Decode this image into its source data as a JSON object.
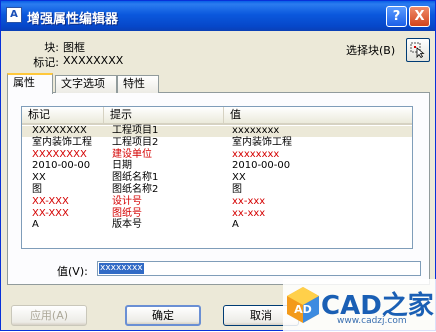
{
  "window": {
    "title": "增强属性编辑器",
    "title_icon": "A",
    "help_glyph": "?",
    "close_glyph": "X"
  },
  "info": {
    "block_label": "块:",
    "block_value": "图框",
    "tag_label": "标记:",
    "tag_value": "XXXXXXXX",
    "select_label": "选择块(B)",
    "select_icon": "pick-cursor-icon"
  },
  "tabs": [
    {
      "label": "属性"
    },
    {
      "label": "文字选项"
    },
    {
      "label": "特性"
    }
  ],
  "table": {
    "headers": [
      "标记",
      "提示",
      "值"
    ],
    "rows": [
      {
        "tag": "XXXXXXXX",
        "prompt": "工程项目1",
        "value": "xxxxxxxx",
        "red": false,
        "selected": true
      },
      {
        "tag": "室内装饰工程",
        "prompt": "工程项目2",
        "value": "室内装饰工程",
        "red": false,
        "selected": false
      },
      {
        "tag": "XXXXXXXX",
        "prompt": "建设单位",
        "value": "xxxxxxxx",
        "red": true,
        "selected": false
      },
      {
        "tag": "2010-00-00",
        "prompt": "日期",
        "value": "2010-00-00",
        "red": false,
        "selected": false
      },
      {
        "tag": "XX",
        "prompt": "图纸名称1",
        "value": "XX",
        "red": false,
        "selected": false
      },
      {
        "tag": "图",
        "prompt": "图纸名称2",
        "value": "图",
        "red": false,
        "selected": false
      },
      {
        "tag": "XX-XXX",
        "prompt": "设计号",
        "value": "xx-xxx",
        "red": true,
        "selected": false
      },
      {
        "tag": "XX-XXX",
        "prompt": "图纸号",
        "value": "xx-xxx",
        "red": true,
        "selected": false
      },
      {
        "tag": "A",
        "prompt": "版本号",
        "value": "A",
        "red": false,
        "selected": false
      }
    ]
  },
  "value_field": {
    "label": "值(V):",
    "value": "xxxxxxxx"
  },
  "buttons": {
    "apply": "应用(A)",
    "ok": "确定",
    "cancel": "取消"
  },
  "watermark": {
    "text": "CAD之家",
    "url": "www.cadzj.com"
  },
  "colors": {
    "title_bar": "#0a58dd",
    "red_text": "#d40000",
    "selection": "#316ac5"
  }
}
